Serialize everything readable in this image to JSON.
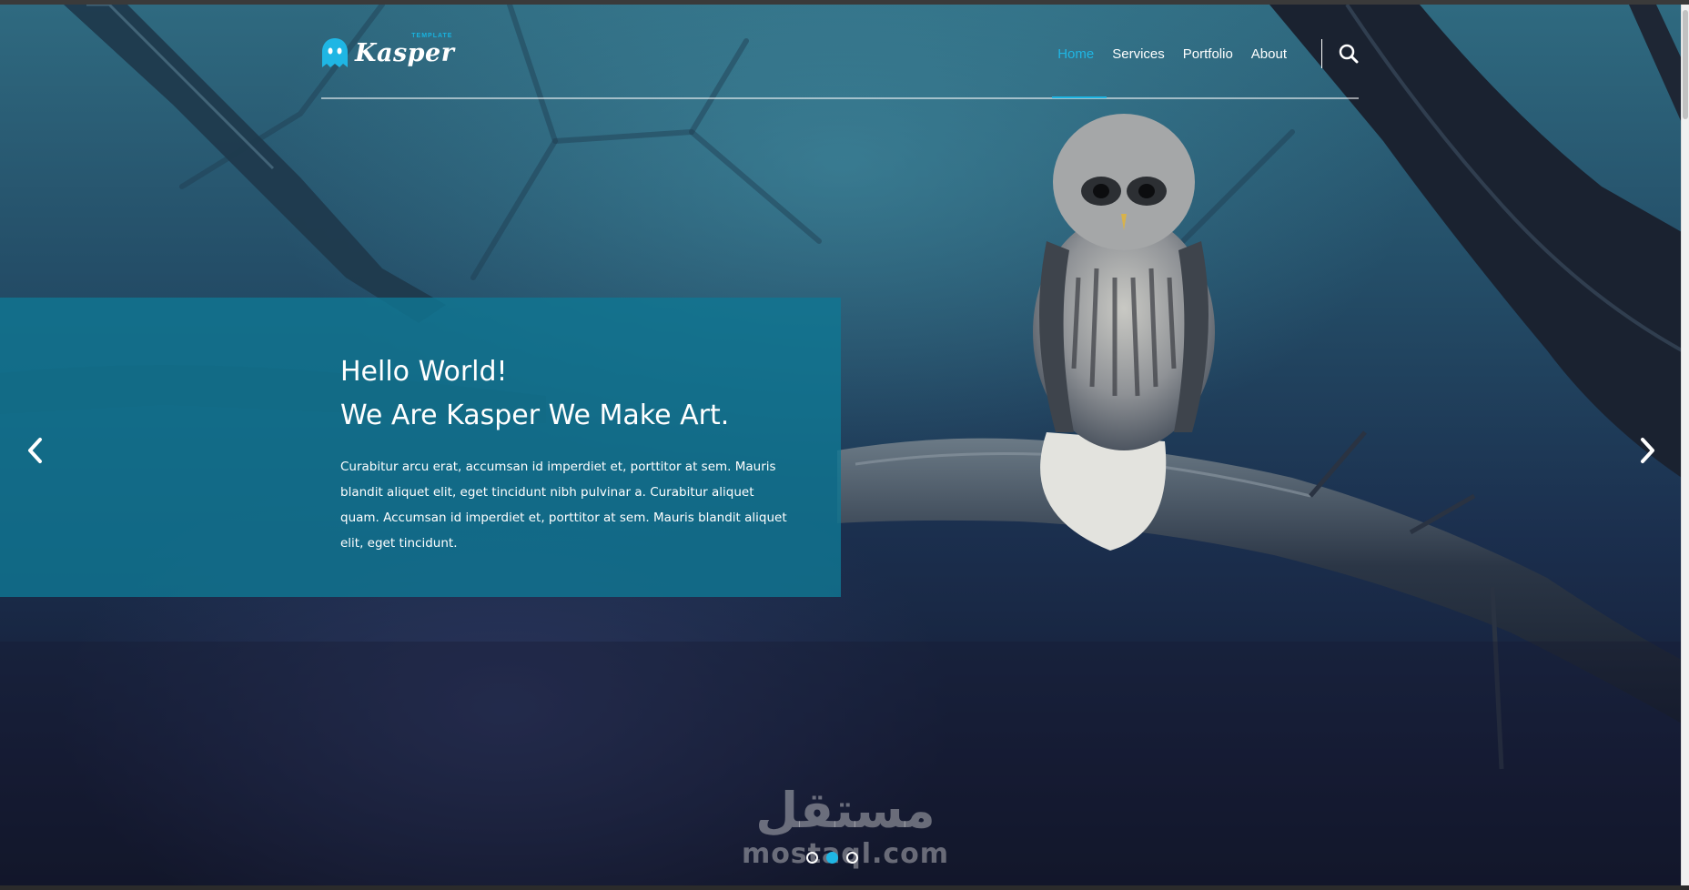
{
  "brand": {
    "name": "Kasper",
    "tagline": "TEMPLATE",
    "icon": "ghost-icon",
    "accent_color": "#1fb6e4"
  },
  "nav": {
    "links": [
      {
        "label": "Home",
        "active": true
      },
      {
        "label": "Services",
        "active": false
      },
      {
        "label": "Portfolio",
        "active": false
      },
      {
        "label": "About",
        "active": false
      }
    ],
    "search_icon": "search-icon"
  },
  "hero": {
    "line1": "Hello World!",
    "line2": "We Are Kasper We Make Art.",
    "description": "Curabitur arcu erat, accumsan id imperdiet et, porttitor at sem. Mauris blandit aliquet elit, eget tincidunt nibh pulvinar a. Curabitur aliquet quam. Accumsan id imperdiet et, porttitor at sem. Mauris blandit aliquet elit, eget tincidunt.",
    "panel_color": "#107692",
    "prev_icon": "chevron-left-icon",
    "next_icon": "chevron-right-icon"
  },
  "slider": {
    "slide_count": 3,
    "active_index": 1
  },
  "watermark": {
    "arabic": "مستقل",
    "latin": "mostaql.com"
  }
}
